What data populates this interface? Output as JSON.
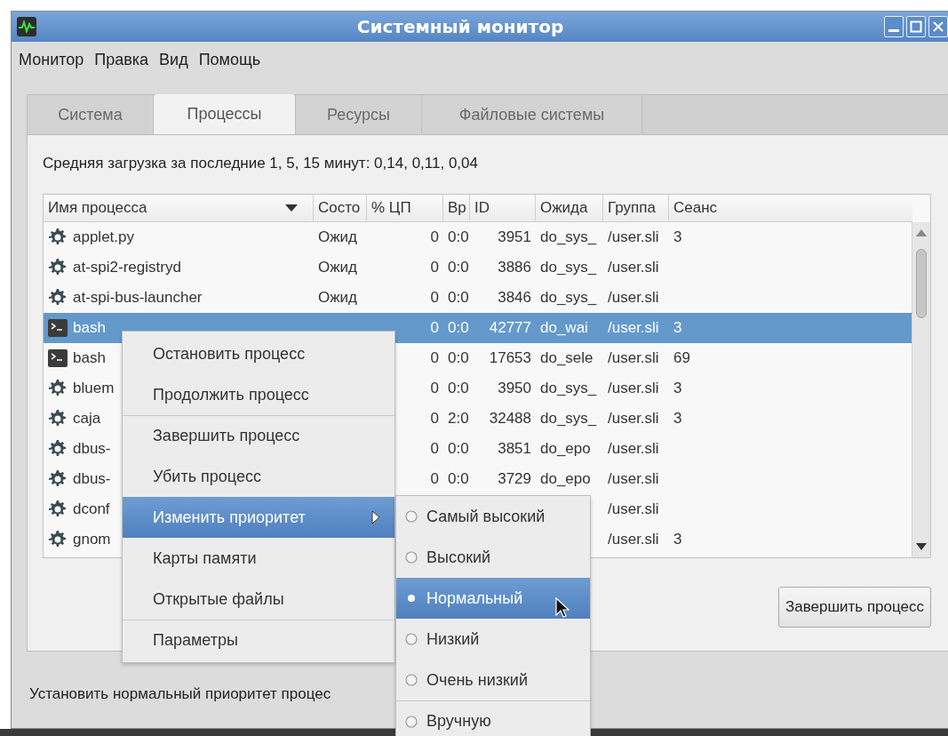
{
  "window": {
    "title": "Системный монитор"
  },
  "menubar": [
    {
      "label": "Монитор"
    },
    {
      "label": "Правка"
    },
    {
      "label": "Вид"
    },
    {
      "label": "Помощь"
    }
  ],
  "tabs": [
    {
      "label": "Система",
      "selected": false
    },
    {
      "label": "Процессы",
      "selected": true
    },
    {
      "label": "Ресурсы",
      "selected": false
    },
    {
      "label": "Файловые системы",
      "selected": false
    }
  ],
  "load_average": "Средняя загрузка за последние 1, 5, 15 минут: 0,14, 0,11, 0,04",
  "table": {
    "columns": [
      {
        "label": "Имя процесса",
        "sorted": true
      },
      {
        "label": "Состо"
      },
      {
        "label": "% ЦП"
      },
      {
        "label": "Вр"
      },
      {
        "label": "ID"
      },
      {
        "label": "Ожида"
      },
      {
        "label": "Группа"
      },
      {
        "label": "Сеанс"
      }
    ],
    "rows": [
      {
        "kind": "daemon",
        "selected": false,
        "name": "applet.py",
        "state": "Ожид",
        "cpu": "0",
        "time": "0:0",
        "id": "3951",
        "wait": "do_sys_",
        "group": "/user.sli",
        "session": "3"
      },
      {
        "kind": "daemon",
        "selected": false,
        "name": "at-spi2-registryd",
        "state": "Ожид",
        "cpu": "0",
        "time": "0:0",
        "id": "3886",
        "wait": "do_sys_",
        "group": "/user.sli"
      },
      {
        "kind": "daemon",
        "selected": false,
        "name": "at-spi-bus-launcher",
        "state": "Ожид",
        "cpu": "0",
        "time": "0:0",
        "id": "3846",
        "wait": "do_sys_",
        "group": "/user.sli"
      },
      {
        "kind": "terminal",
        "selected": true,
        "name": "bash",
        "cpu": "0",
        "time": "0:0",
        "id": "42777",
        "wait": "do_wai",
        "group": "/user.sli",
        "session": "3"
      },
      {
        "kind": "terminal",
        "selected": false,
        "name": "bash",
        "cpu": "0",
        "time": "0:0",
        "id": "17653",
        "wait": "do_sele",
        "group": "/user.sli",
        "session": "69"
      },
      {
        "kind": "daemon",
        "selected": false,
        "name": "bluem",
        "cpu": "0",
        "time": "0:0",
        "id": "3950",
        "wait": "do_sys_",
        "group": "/user.sli",
        "session": "3"
      },
      {
        "kind": "daemon",
        "selected": false,
        "name": "caja",
        "cpu": "0",
        "time": "2:0",
        "id": "32488",
        "wait": "do_sys_",
        "group": "/user.sli",
        "session": "3"
      },
      {
        "kind": "daemon",
        "selected": false,
        "name": "dbus-",
        "cpu": "0",
        "time": "0:0",
        "id": "3851",
        "wait": "do_epo",
        "group": "/user.sli"
      },
      {
        "kind": "daemon",
        "selected": false,
        "name": "dbus-",
        "cpu": "0",
        "time": "0:0",
        "id": "3729",
        "wait": "do_epo",
        "group": "/user.sli"
      },
      {
        "kind": "daemon",
        "selected": false,
        "name": "dconf",
        "group": "/user.sli"
      },
      {
        "kind": "daemon",
        "selected": false,
        "name": "gnom",
        "group": "/user.sli",
        "session": "3"
      }
    ]
  },
  "end_process_button": "Завершить процесс",
  "status_bar": "Установить нормальный приоритет процес",
  "context_menu": {
    "items": [
      {
        "label": "Остановить процесс",
        "selected": false,
        "separator_before": false,
        "has_submenu": false
      },
      {
        "label": "Продолжить процесс",
        "selected": false,
        "separator_before": false,
        "has_submenu": false
      },
      {
        "label": "Завершить процесс",
        "selected": false,
        "separator_before": true,
        "has_submenu": false
      },
      {
        "label": "Убить процесс",
        "selected": false,
        "separator_before": false,
        "has_submenu": false
      },
      {
        "label": "Изменить приоритет",
        "selected": true,
        "separator_before": false,
        "has_submenu": true
      },
      {
        "label": "Карты памяти",
        "selected": false,
        "separator_before": false,
        "has_submenu": false
      },
      {
        "label": "Открытые файлы",
        "selected": false,
        "separator_before": false,
        "has_submenu": false
      },
      {
        "label": "Параметры",
        "selected": false,
        "separator_before": true,
        "has_submenu": false
      }
    ]
  },
  "priority_menu": {
    "items": [
      {
        "label": "Самый высокий",
        "checked": false,
        "selected": false,
        "separator_before": false
      },
      {
        "label": "Высокий",
        "checked": false,
        "selected": false,
        "separator_before": false
      },
      {
        "label": "Нормальный",
        "checked": true,
        "selected": true,
        "separator_before": false
      },
      {
        "label": "Низкий",
        "checked": false,
        "selected": false,
        "separator_before": false
      },
      {
        "label": "Очень низкий",
        "checked": false,
        "selected": false,
        "separator_before": false
      },
      {
        "label": "Вручную",
        "checked": false,
        "selected": false,
        "separator_before": true
      }
    ]
  }
}
